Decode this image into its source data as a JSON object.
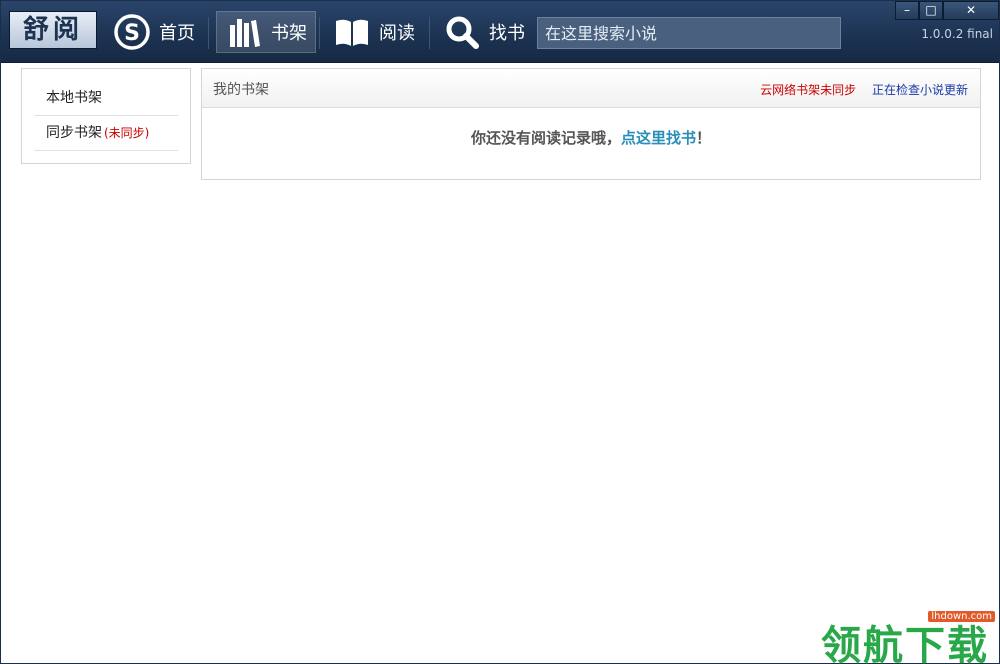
{
  "app": {
    "logo": "舒阅",
    "version": "1.0.0.2 final"
  },
  "nav": {
    "home": "首页",
    "shelf": "书架",
    "read": "阅读",
    "find": "找书"
  },
  "search": {
    "placeholder": "在这里搜索小说"
  },
  "window_controls": {
    "minimize": "–",
    "maximize": "□",
    "close": "✕"
  },
  "sidebar": {
    "items": [
      {
        "label": "本地书架",
        "note": ""
      },
      {
        "label": "同步书架",
        "note": "(未同步)"
      }
    ]
  },
  "panel": {
    "title": "我的书架",
    "sync_status": "云网络书架未同步",
    "update_status": "正在检查小说更新",
    "empty_message": "你还没有阅读记录哦，",
    "empty_link": "点这里找书",
    "empty_suffix": "！"
  },
  "watermark": {
    "text": "领航下载",
    "url": "lhdown.com"
  },
  "colors": {
    "topbar": "#1c3250",
    "accent_link": "#2a8fb8",
    "warning": "#cc0000",
    "info_link": "#1a3aa8",
    "watermark": "#29a84a"
  }
}
